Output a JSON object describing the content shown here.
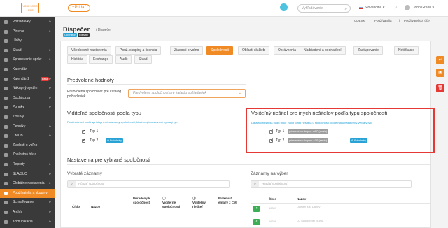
{
  "topbar": {
    "logo": "YOUR LOGO HERE",
    "add_label": "+Pridať",
    "search_placeholder": "Vyhľadávanie",
    "language": "Slovenčina",
    "user": "John Green"
  },
  "sidebar": {
    "items": [
      {
        "label": "Požiadavky",
        "arrow": "▸"
      },
      {
        "label": "Plnenia",
        "arrow": "▸"
      },
      {
        "label": "Úlohy",
        "arrow": ""
      },
      {
        "label": "Sklad",
        "arrow": "▸"
      },
      {
        "label": "Spracovanie správ",
        "arrow": "▸"
      },
      {
        "label": "Kalendár",
        "arrow": ""
      },
      {
        "label": "Kalendár 2",
        "arrow": "▸",
        "badge": "Beta"
      },
      {
        "label": "Nákupný systém",
        "arrow": "▸"
      },
      {
        "label": "Dochádzka",
        "arrow": "▸"
      },
      {
        "label": "Ponuky",
        "arrow": "▸"
      },
      {
        "label": "Zmluvy",
        "arrow": ""
      },
      {
        "label": "Cenníky",
        "arrow": "▸"
      },
      {
        "label": "CMDB",
        "arrow": "▸"
      },
      {
        "label": "Žiadosti o voľno",
        "arrow": ""
      },
      {
        "label": "Znalostná báza",
        "arrow": ""
      },
      {
        "label": "Reporty",
        "arrow": "▸"
      },
      {
        "label": "SLA/SLO",
        "arrow": "▸"
      },
      {
        "label": "Globálne nastavenia",
        "arrow": "▸"
      },
      {
        "label": "Používatelia a skupiny",
        "arrow": "",
        "active": true
      },
      {
        "label": "Schvaľovanie",
        "arrow": "▸"
      },
      {
        "label": "Archív",
        "arrow": "▸"
      },
      {
        "label": "Komunikácia",
        "arrow": "▸"
      }
    ]
  },
  "crumbs": {
    "cdesk": "CDESK",
    "users": "Používatelia",
    "account": "Používateľský účet"
  },
  "header": {
    "title": "Dispečer",
    "sub": "/ Dispečer",
    "badge1": "Operátor",
    "badge2": "Riešiteľ"
  },
  "tabs": [
    "Všeobecné nastavenia",
    "Použ. skupiny a licencia",
    "Žiadosti o voľno",
    "Spoločnosti",
    "Oblasti služieb",
    "Oprávnenia",
    "Nadriadení a podriadení",
    "Zastupovanie",
    "Notifikácie",
    "História",
    "Exchange",
    "Audit",
    "Sklad"
  ],
  "defaults": {
    "title": "Predvolené hodnoty",
    "field_label": "Predvolená spoločnosť pre katalóg požiadaviek",
    "select_placeholder": "Predvolená spoločnosť pre katalóg požiadaviek"
  },
  "visible": {
    "title": "Viditeľné spoločnosti podľa typu",
    "desc": "Používateľovi budú sprístupnené záznamy spoločností, ktoré majú nastavený vybratý typ.",
    "items": [
      {
        "label": "Typ 1",
        "tag": ""
      },
      {
        "label": "Typ 2",
        "tag": "Poliadavky"
      }
    ]
  },
  "solvers": {
    "title": "Voliteľný riešiteľ pre iných riešiteľov podľa typu spoločnosti",
    "desc": "Dataláni riešitelia budú môcť zvoliť tohto riešiteľa u spoločností, ktoré majú nastavený vybratý typ.",
    "items": [
      {
        "label": "Typ 1",
        "tag_grey": "priradené na skupiny: AGP (servis)",
        "tag_blue": ""
      },
      {
        "label": "Typ 2",
        "tag_grey": "priradené na skupiny: AGP (servis)",
        "tag_blue": "Poliadavky"
      }
    ]
  },
  "selected": {
    "title": "Nastavenia pre vybrané spoločnosti",
    "left_title": "Vybraté záznamy",
    "right_title": "Záznamy na výber",
    "filter_placeholder": "Hľadať spoločnosť",
    "left_headers": [
      "Číslo",
      "Názov",
      "Priradený k spoločnosti",
      "Viditeľné spoločnosti",
      "Voliteľný riešiteľ",
      "Blokovať emaily z CM"
    ],
    "right_headers": [
      "Číslo",
      "Názov"
    ],
    "right_rows": [
      {
        "num": "16301",
        "name": "Dalsitel a.s. Danev"
      },
      {
        "num": "16338",
        "name": "DJ Spoločnosť pluma"
      }
    ]
  },
  "colors": {
    "accent": "#f08a24",
    "info": "#29a3d6",
    "danger": "#e53935",
    "sidebar": "#3a3a3a"
  }
}
